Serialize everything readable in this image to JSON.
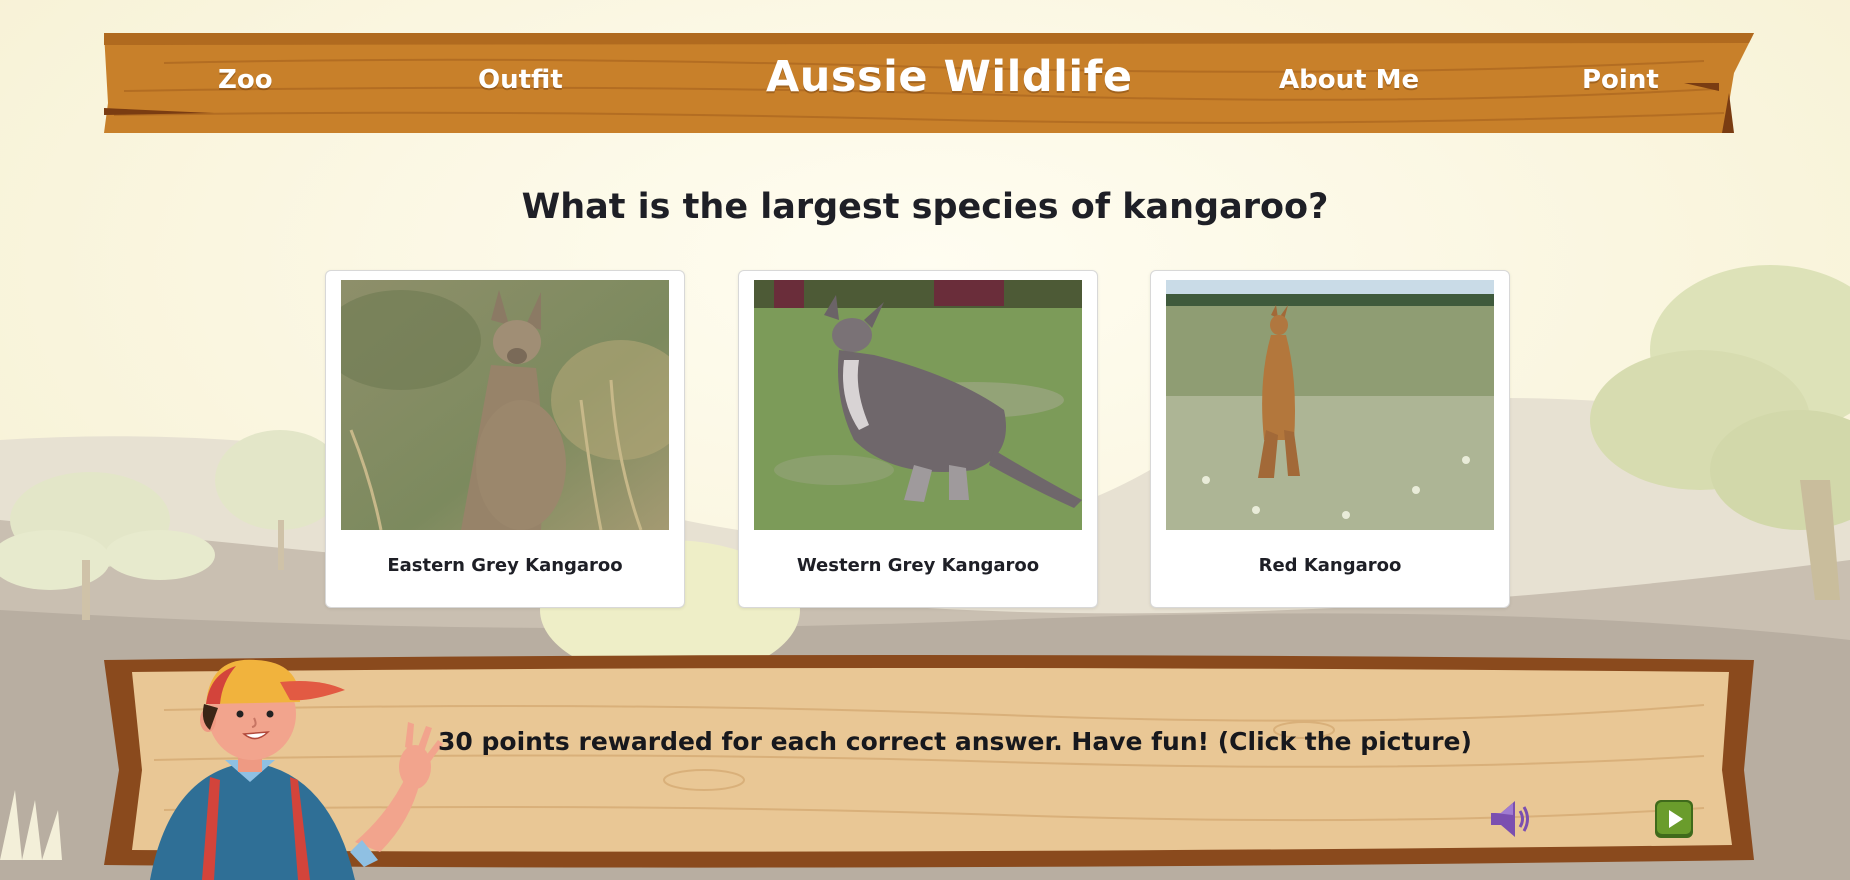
{
  "nav": {
    "title": "Aussie Wildlife",
    "links": [
      {
        "label": "Zoo"
      },
      {
        "label": "Outfit"
      },
      {
        "label": "About Me"
      },
      {
        "label": "Point"
      }
    ]
  },
  "quiz": {
    "question": "What is the largest species of kangaroo?",
    "options": [
      {
        "label": "Eastern Grey Kangaroo",
        "icon": "kangaroo-photo"
      },
      {
        "label": "Western Grey Kangaroo",
        "icon": "kangaroo-photo"
      },
      {
        "label": "Red Kangaroo",
        "icon": "kangaroo-photo"
      }
    ]
  },
  "footer": {
    "message": "30 points rewarded for each correct answer. Have fun! (Click the picture)",
    "sound_icon": "speaker-icon",
    "play_icon": "play-icon"
  },
  "colors": {
    "plank": "#c8802a",
    "board": "#e9c795",
    "sound": "#7b4fb0",
    "play": "#6a9c2c",
    "text": "#1e1f26"
  }
}
